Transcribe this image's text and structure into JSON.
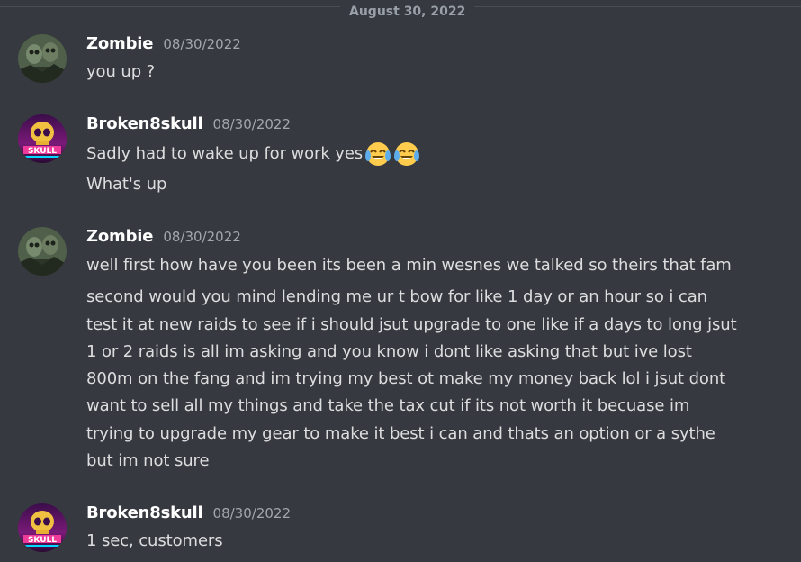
{
  "date_divider": "August 30, 2022",
  "messages": [
    {
      "author": "Zombie",
      "timestamp": "08/30/2022",
      "avatar": "zombie-avatar",
      "lines": [
        "you up ?"
      ]
    },
    {
      "author": "Broken8skull",
      "timestamp": "08/30/2022",
      "avatar": "skull-avatar",
      "lines": [
        "Sadly had to wake up for work yes",
        "What's up"
      ],
      "emoji": [
        "face-with-tears-of-joy",
        "face-with-tears-of-joy"
      ]
    },
    {
      "author": "Zombie",
      "timestamp": "08/30/2022",
      "avatar": "zombie-avatar",
      "lines": [
        "well first how have you been its been a min wesnes we talked so theirs that fam",
        "second would you mind lending me ur t bow for like 1 day or an hour so i can",
        "test it at new raids to see if i should jsut upgrade to one like if a days to long jsut",
        "1  or 2 raids is all im asking and you know i dont like asking that but ive lost",
        "800m on the fang and im trying my best ot make my money back lol i jsut dont",
        "want to sell all my things and take the tax cut if its not worth it  becuase im",
        "trying to upgrade my gear to make it best i can and thats an option or a sythe",
        "but im not sure"
      ]
    },
    {
      "author": "Broken8skull",
      "timestamp": "08/30/2022",
      "avatar": "skull-avatar",
      "lines": [
        "1 sec, customers"
      ]
    }
  ],
  "colors": {
    "background": "#36393f",
    "username": "#ffffff",
    "timestamp": "#a3a6aa",
    "text": "#dcddde",
    "divider": "#4a4d53"
  }
}
